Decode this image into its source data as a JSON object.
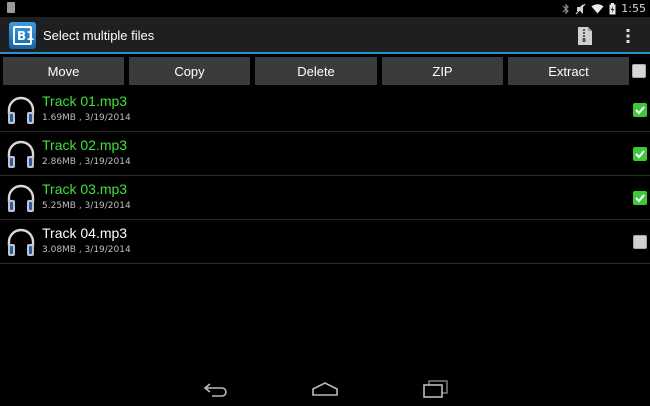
{
  "status_bar": {
    "time": "1:55",
    "icons": [
      "notification-icon",
      "bluetooth-icon",
      "mute-icon",
      "wifi-icon",
      "battery-icon"
    ]
  },
  "action_bar": {
    "app_icon_text": "B1",
    "title": "Select multiple files",
    "icons": [
      "archive-icon",
      "overflow-menu-icon"
    ]
  },
  "toolbar": {
    "buttons": [
      "Move",
      "Copy",
      "Delete",
      "ZIP",
      "Extract"
    ],
    "select_all_checked": false
  },
  "files": [
    {
      "name": "Track 01.mp3",
      "meta": "1.69MB , 3/19/2014",
      "selected": true
    },
    {
      "name": "Track 02.mp3",
      "meta": "2.86MB , 3/19/2014",
      "selected": true
    },
    {
      "name": "Track 03.mp3",
      "meta": "5.25MB , 3/19/2014",
      "selected": true
    },
    {
      "name": "Track 04.mp3",
      "meta": "3.08MB , 3/19/2014",
      "selected": false
    }
  ],
  "colors": {
    "accent": "#2c8fd1",
    "selected_text": "#3fe03a",
    "unselected_text": "#ffffff",
    "checkbox_on": "#3fc93a"
  },
  "nav": [
    "back-icon",
    "home-icon",
    "recents-icon"
  ]
}
